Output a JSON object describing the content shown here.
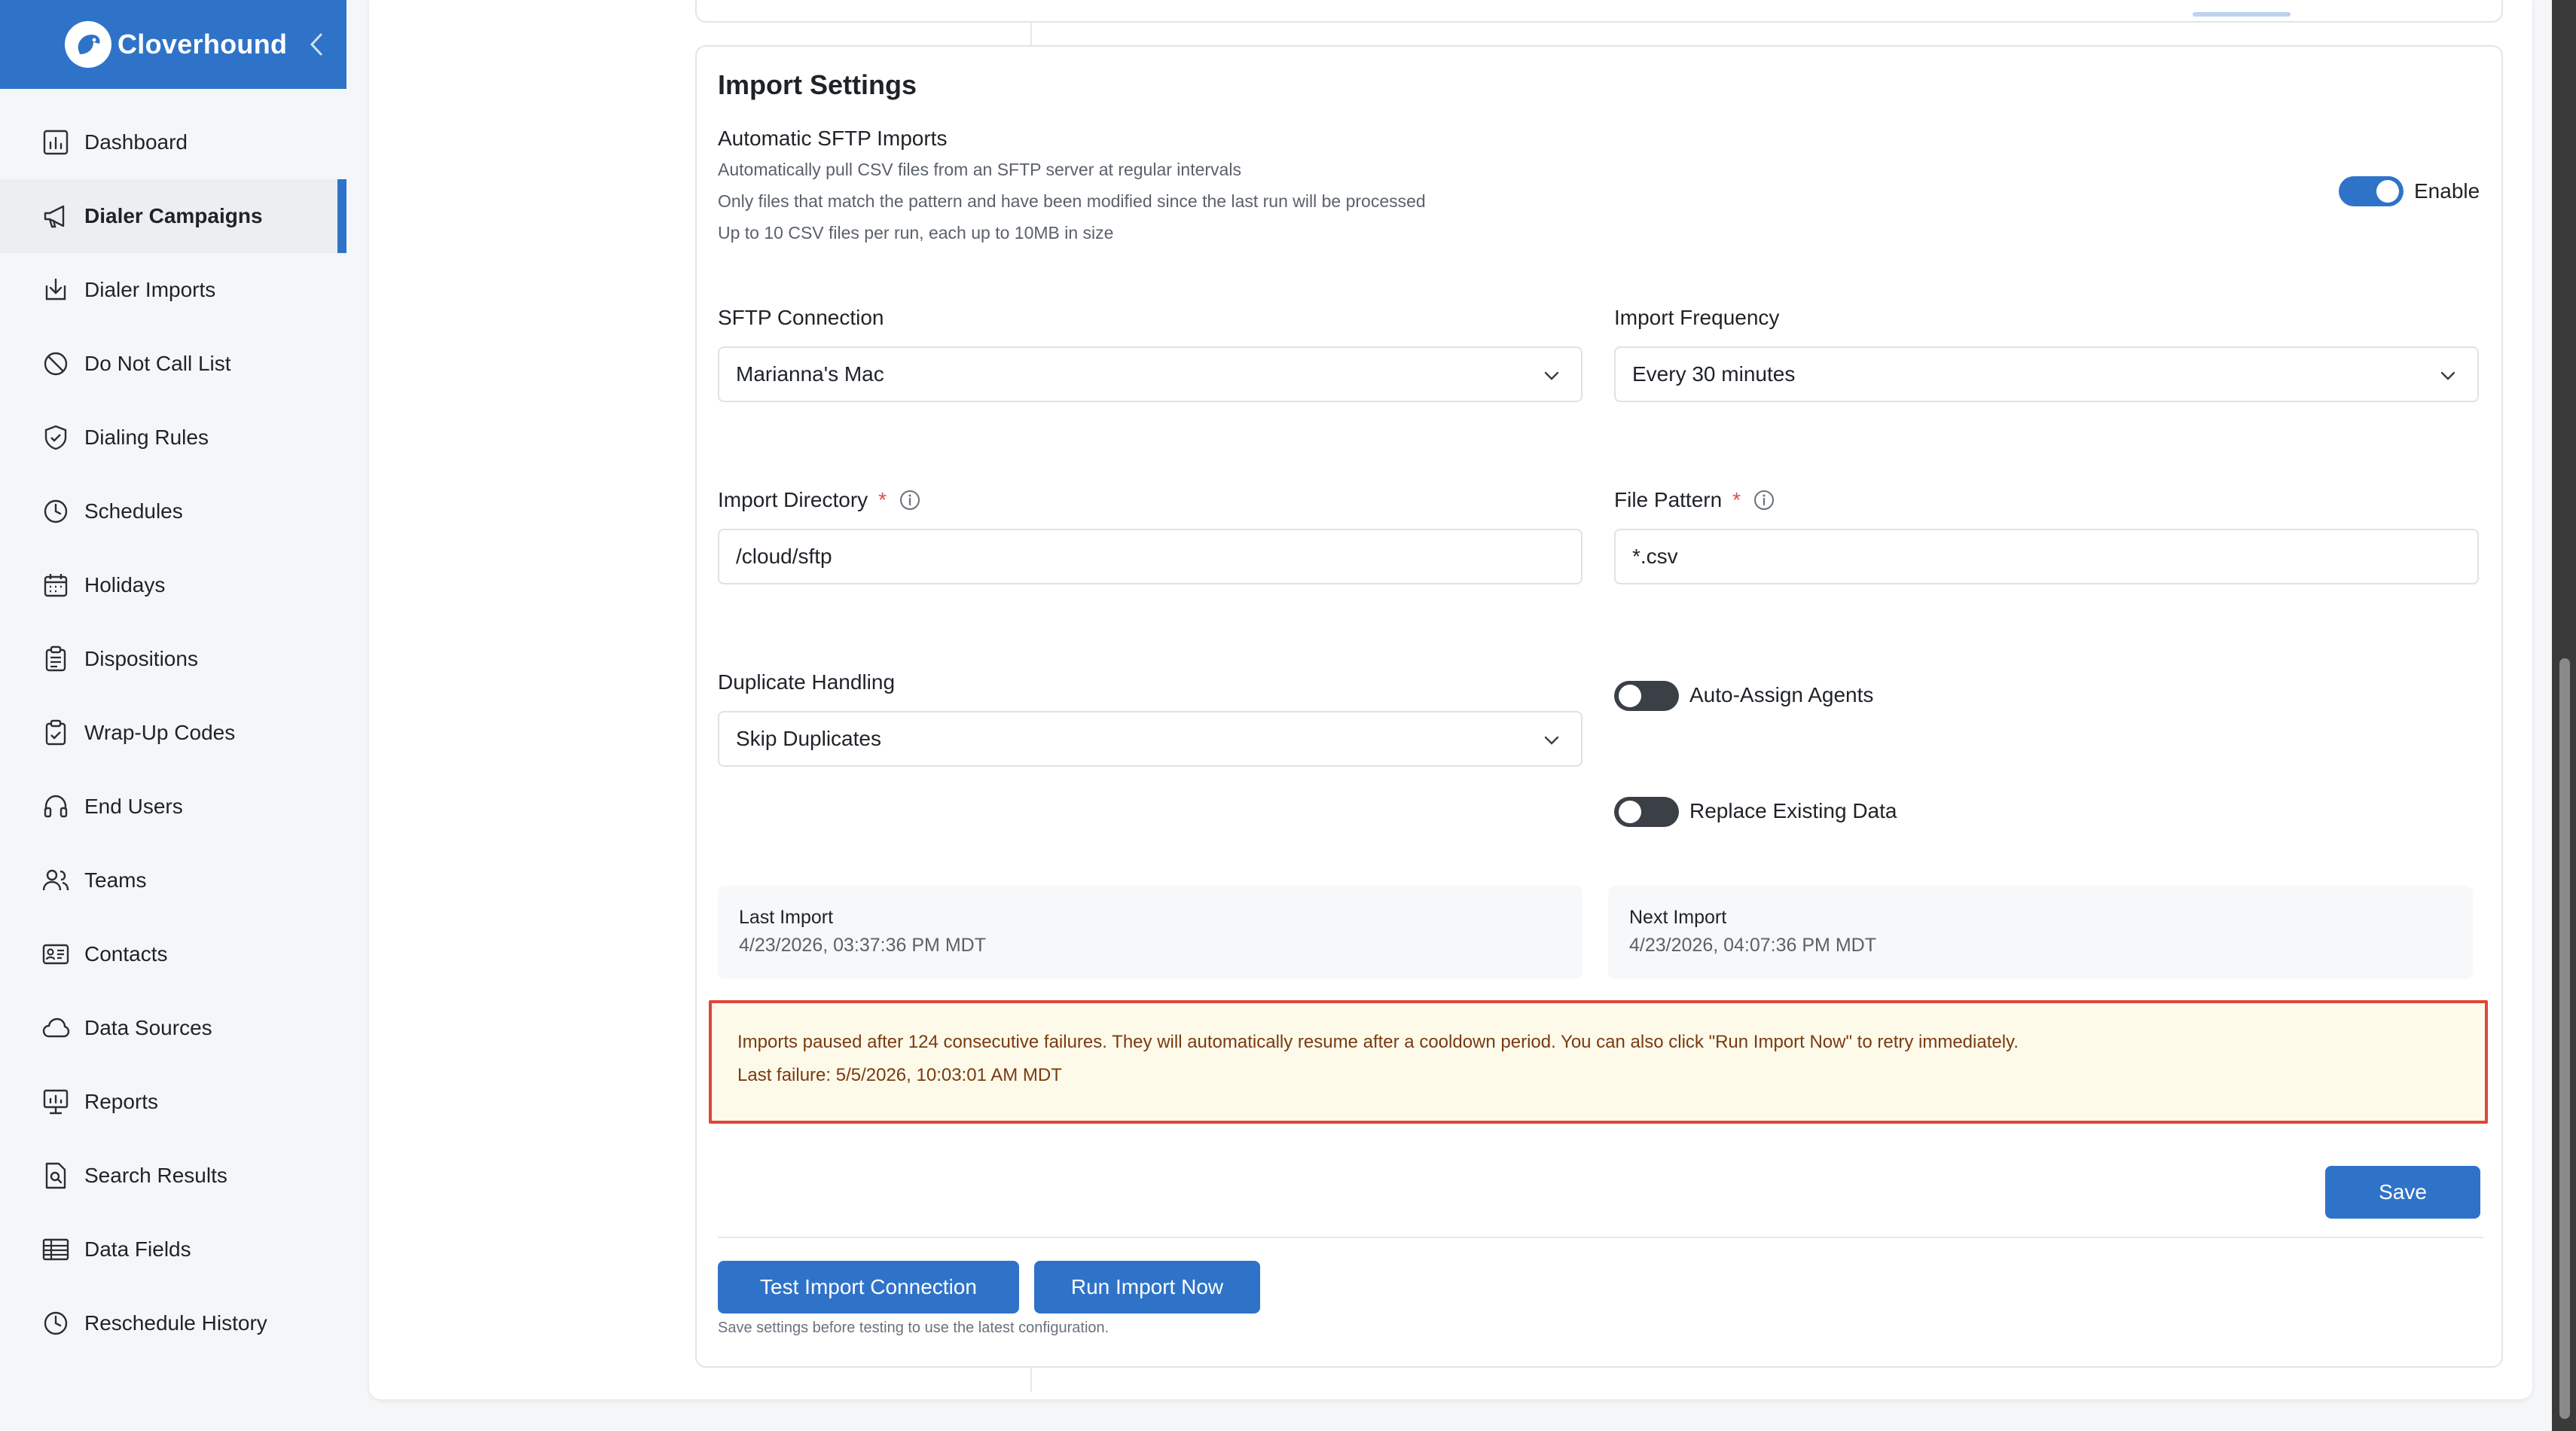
{
  "brand": {
    "name": "Cloverhound"
  },
  "sidebar": {
    "items": [
      {
        "label": "Dashboard",
        "icon": "bar-chart-icon"
      },
      {
        "label": "Dialer Campaigns",
        "icon": "megaphone-icon",
        "active": true
      },
      {
        "label": "Dialer Imports",
        "icon": "import-icon"
      },
      {
        "label": "Do Not Call List",
        "icon": "block-icon"
      },
      {
        "label": "Dialing Rules",
        "icon": "shield-icon"
      },
      {
        "label": "Schedules",
        "icon": "clock-icon"
      },
      {
        "label": "Holidays",
        "icon": "calendar-icon"
      },
      {
        "label": "Dispositions",
        "icon": "clipboard-icon"
      },
      {
        "label": "Wrap-Up Codes",
        "icon": "clipboard-check-icon"
      },
      {
        "label": "End Users",
        "icon": "headset-icon"
      },
      {
        "label": "Teams",
        "icon": "users-icon"
      },
      {
        "label": "Contacts",
        "icon": "contact-card-icon"
      },
      {
        "label": "Data Sources",
        "icon": "cloud-icon"
      },
      {
        "label": "Reports",
        "icon": "presentation-icon"
      },
      {
        "label": "Search Results",
        "icon": "file-search-icon"
      },
      {
        "label": "Data Fields",
        "icon": "table-icon"
      },
      {
        "label": "Reschedule History",
        "icon": "history-icon"
      }
    ]
  },
  "import_settings": {
    "title": "Import Settings",
    "sftp": {
      "title": "Automatic SFTP Imports",
      "desc1": "Automatically pull CSV files from an SFTP server at regular intervals",
      "desc2": "Only files that match the pattern and have been modified since the last run will be processed",
      "desc3": "Up to 10 CSV files per run, each up to 10MB in size",
      "enable_label": "Enable",
      "enabled": true
    },
    "sftp_connection": {
      "label": "SFTP Connection",
      "value": "Marianna's Mac"
    },
    "import_frequency": {
      "label": "Import Frequency",
      "value": "Every 30 minutes"
    },
    "import_directory": {
      "label": "Import Directory",
      "required": "*",
      "value": "/cloud/sftp"
    },
    "file_pattern": {
      "label": "File Pattern",
      "required": "*",
      "value": "*.csv"
    },
    "duplicate_handling": {
      "label": "Duplicate Handling",
      "value": "Skip Duplicates"
    },
    "auto_assign": {
      "label": "Auto-Assign Agents",
      "enabled": false
    },
    "replace_existing": {
      "label": "Replace Existing Data",
      "enabled": false
    },
    "last_import": {
      "label": "Last Import",
      "value": "4/23/2026, 03:37:36 PM MDT"
    },
    "next_import": {
      "label": "Next Import",
      "value": "4/23/2026, 04:07:36 PM MDT"
    },
    "alert": {
      "message": "Imports paused after 124 consecutive failures. They will automatically resume after a cooldown period. You can also click \"Run Import Now\" to retry immediately.",
      "last_failure": "Last failure: 5/5/2026, 10:03:01 AM MDT"
    },
    "save_label": "Save",
    "test_connection_label": "Test Import Connection",
    "run_import_label": "Run Import Now",
    "hint": "Save settings before testing to use the latest configuration."
  },
  "colors": {
    "primary": "#2f73c9",
    "alert_border": "#e0453a",
    "alert_bg": "#fdfaea"
  }
}
